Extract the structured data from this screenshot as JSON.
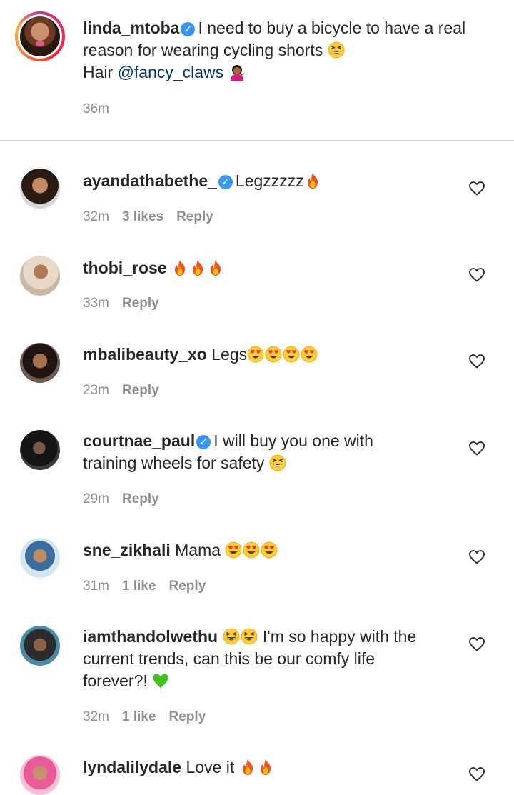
{
  "post": {
    "username": "linda_mtoba",
    "caption_1": "I need to buy a bicycle to have a real",
    "caption_2": "reason for wearing cycling shorts",
    "caption_3_prefix": "Hair",
    "mention": "@fancy_claws",
    "time": "36m"
  },
  "comments": [
    {
      "username": "ayandathabethe_",
      "verified": true,
      "text": "Legzzzzz",
      "time": "32m",
      "likes": "3 likes",
      "reply": "Reply"
    },
    {
      "username": "thobi_rose",
      "verified": false,
      "text": "",
      "time": "33m",
      "likes": "",
      "reply": "Reply"
    },
    {
      "username": "mbalibeauty_xo",
      "verified": false,
      "text": "Legs",
      "time": "23m",
      "likes": "",
      "reply": "Reply"
    },
    {
      "username": "courtnae_paul",
      "verified": true,
      "text_1": "I will buy you one with",
      "text_2": "training wheels for safety",
      "time": "29m",
      "likes": "",
      "reply": "Reply"
    },
    {
      "username": "sne_zikhali",
      "verified": false,
      "text": "Mama",
      "time": "31m",
      "likes": "1 like",
      "reply": "Reply"
    },
    {
      "username": "iamthandolwethu",
      "verified": false,
      "text_1": "I'm so happy with the",
      "text_2": "current trends, can this be our comfy life",
      "text_3": "forever?!",
      "time": "32m",
      "likes": "1 like",
      "reply": "Reply"
    },
    {
      "username": "lyndalilydale",
      "verified": false,
      "text": "Love it",
      "time": "",
      "likes": "",
      "reply": ""
    }
  ],
  "icons": {
    "verified": "verified-badge-icon",
    "heart": "heart-outline-icon",
    "fire": "fire-emoji",
    "laugh": "grinning-sweat-emoji",
    "heart_eyes": "heart-eyes-emoji",
    "green_heart": "green-heart-emoji",
    "shrug": "person-tipping-hand-emoji"
  },
  "colors": {
    "link": "#00376b",
    "meta": "#8e8e8e",
    "verified": "#3897f0",
    "text": "#262626"
  }
}
